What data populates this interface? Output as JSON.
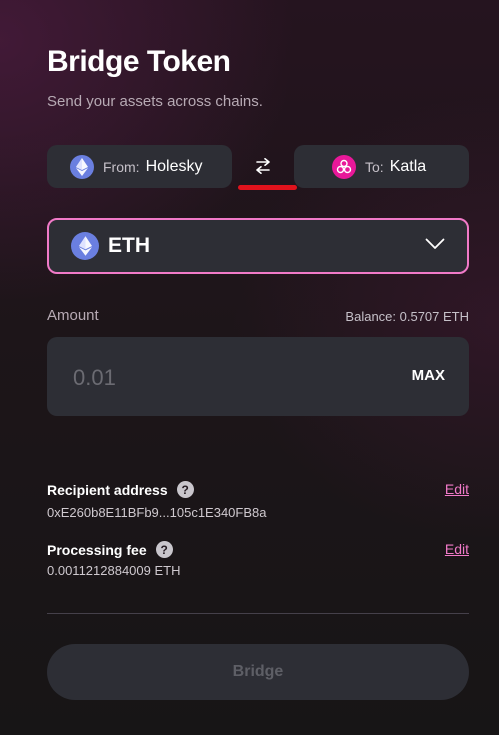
{
  "header": {
    "title": "Bridge Token",
    "subtitle": "Send your assets across chains."
  },
  "from_chain": {
    "label": "From:",
    "value": "Holesky",
    "icon": "ethereum-icon"
  },
  "to_chain": {
    "label": "To:",
    "value": "Katla",
    "icon": "katla-icon"
  },
  "swap": {
    "icon": "swap-arrows-icon"
  },
  "token": {
    "symbol": "ETH",
    "icon": "ethereum-icon"
  },
  "amount": {
    "label": "Amount",
    "balance": "Balance: 0.5707 ETH",
    "placeholder": "0.01",
    "max_label": "MAX"
  },
  "recipient": {
    "label": "Recipient address",
    "value": "0xE260b8E11BFb9...105c1E340FB8a",
    "edit_label": "Edit"
  },
  "fee": {
    "label": "Processing fee",
    "value": "0.0011212884009 ETH",
    "edit_label": "Edit"
  },
  "help_glyph": "?",
  "bridge_button": {
    "label": "Bridge"
  },
  "colors": {
    "accent_pink": "#f17ac8",
    "eth_blue": "#6a7fe0",
    "katla_pink": "#e81899",
    "underline_red": "#e0121c",
    "surface": "#2d2e35"
  }
}
